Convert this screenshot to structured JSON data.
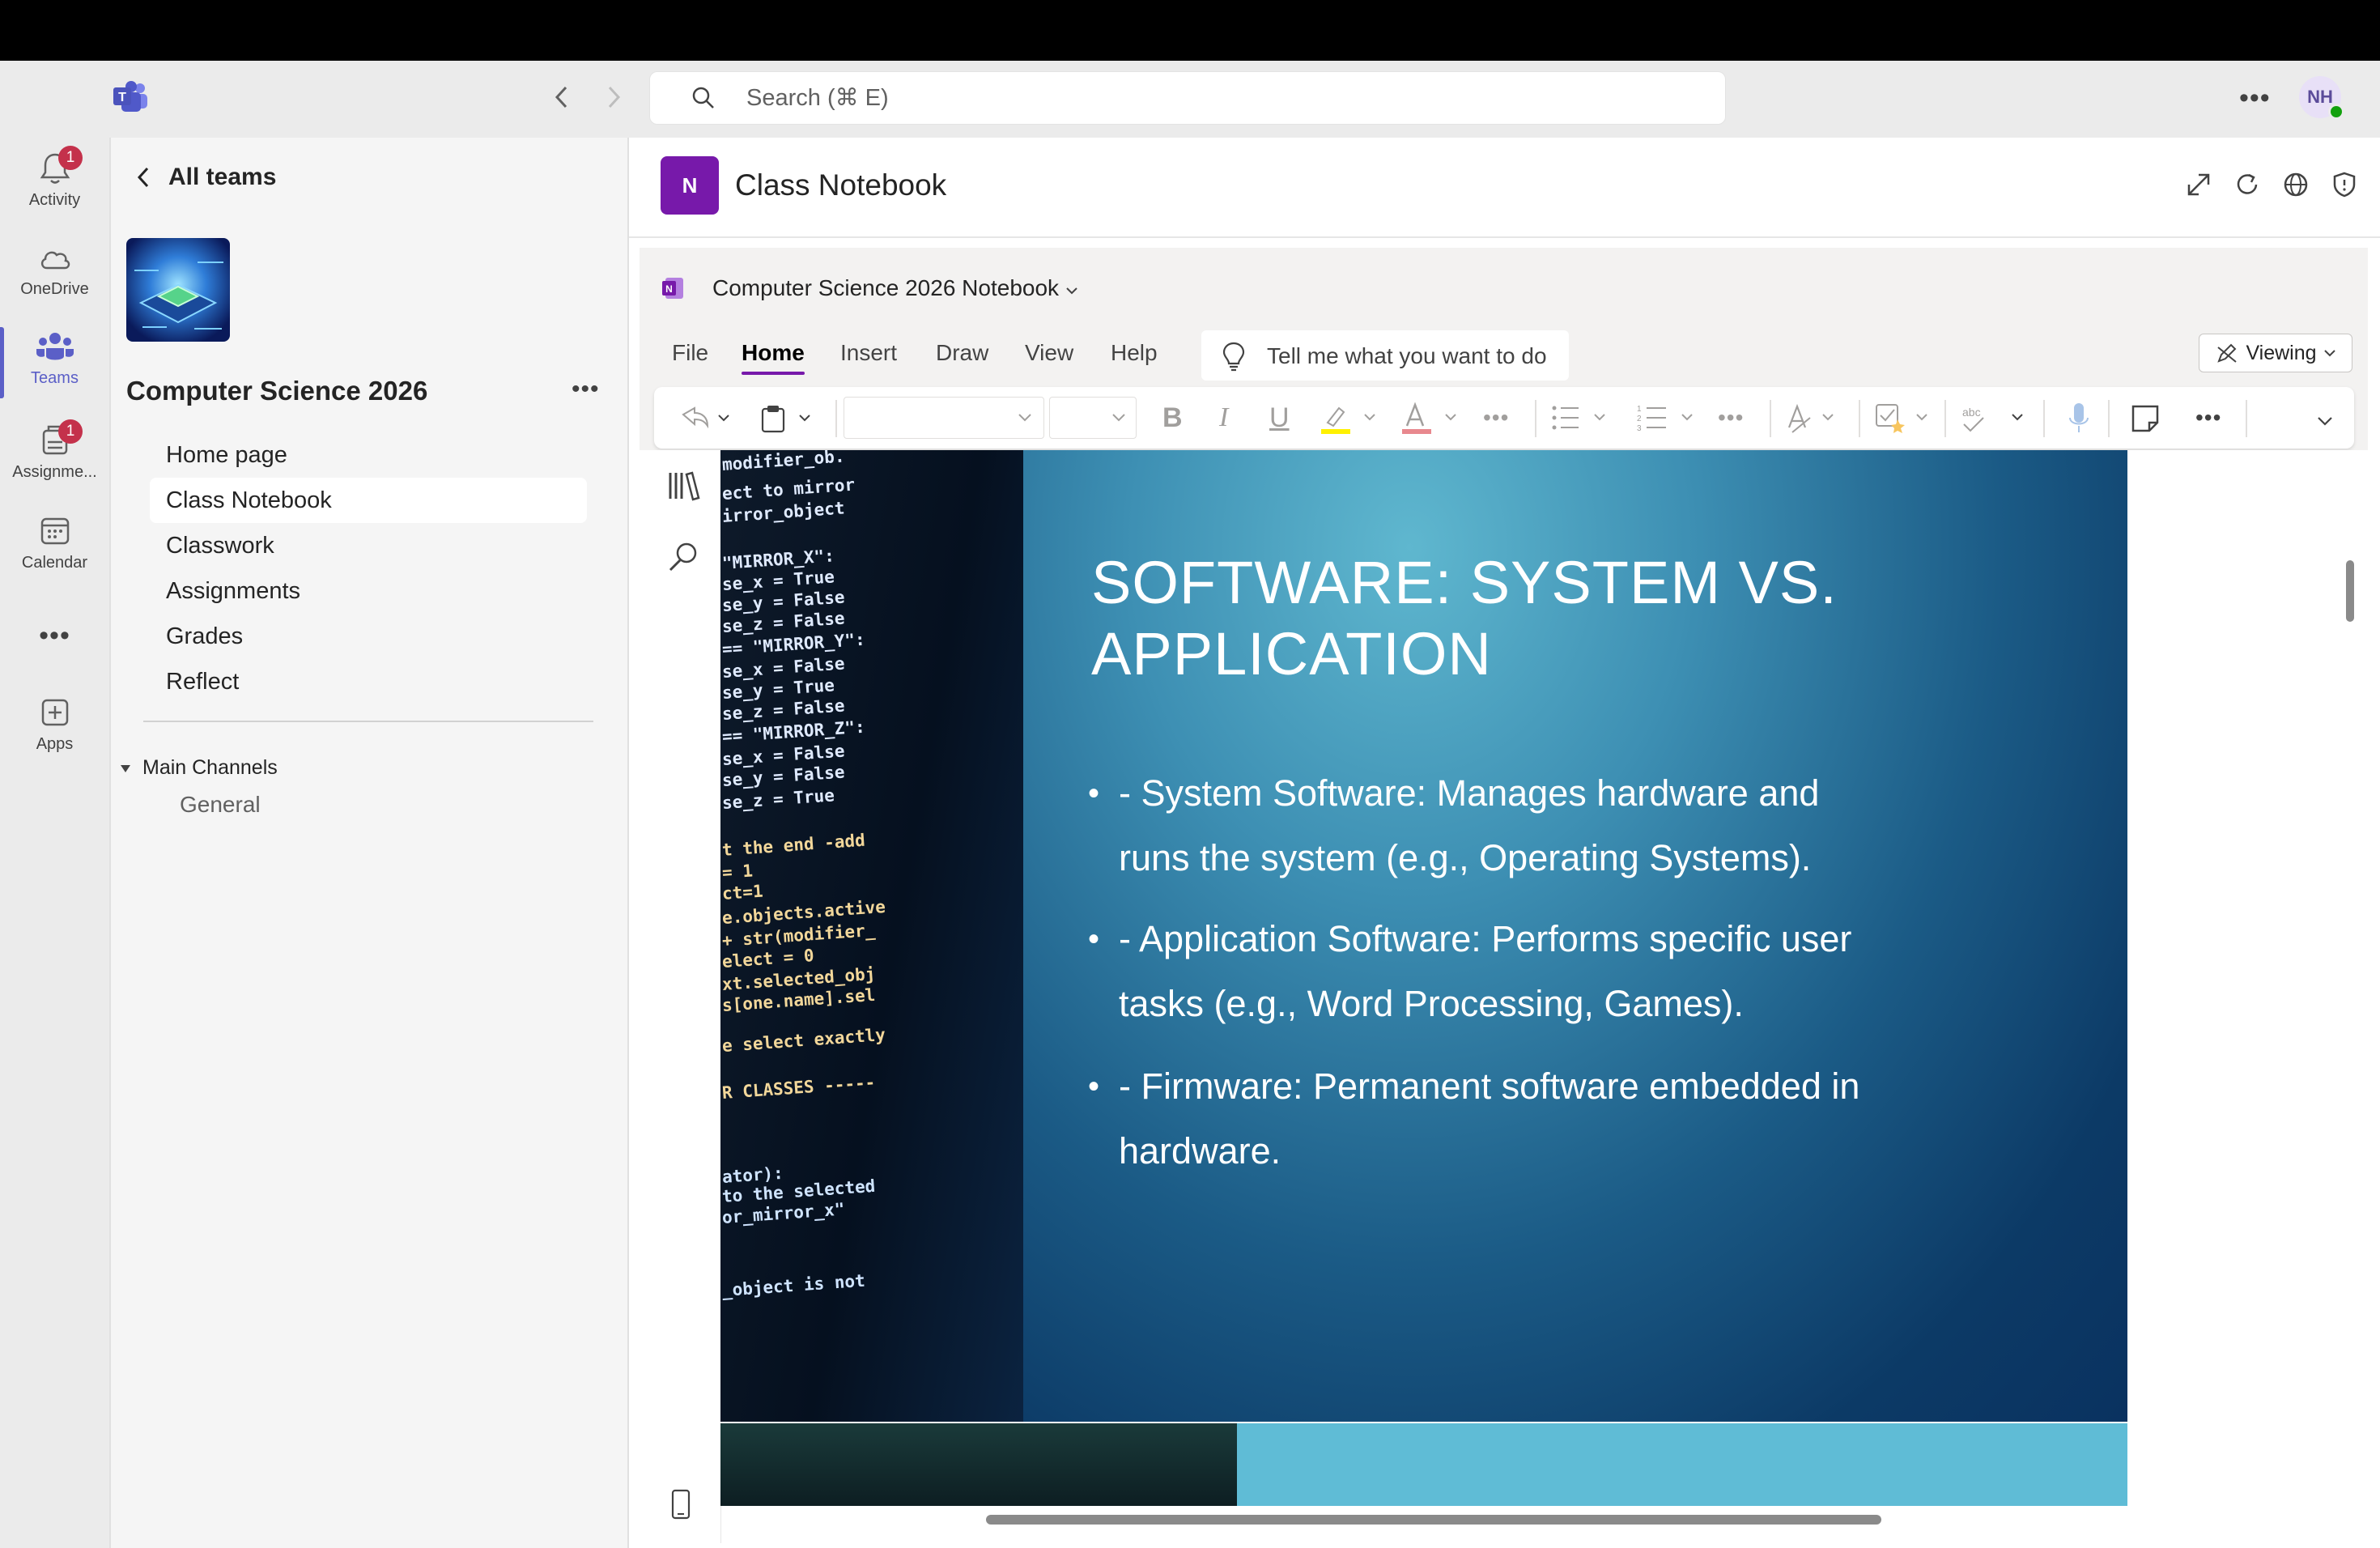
{
  "search": {
    "placeholder": "Search (⌘ E)"
  },
  "user": {
    "initials": "NH"
  },
  "rail": {
    "items": [
      {
        "label": "Activity",
        "badge": "1",
        "icon": "bell-icon"
      },
      {
        "label": "OneDrive",
        "icon": "cloud-icon"
      },
      {
        "label": "Teams",
        "icon": "teams-icon"
      },
      {
        "label": "Assignme...",
        "badge": "1",
        "icon": "assignments-icon"
      },
      {
        "label": "Calendar",
        "icon": "calendar-icon"
      },
      {
        "label": "Apps",
        "icon": "add-app-icon"
      }
    ]
  },
  "panel": {
    "back_label": "All teams",
    "team_name": "Computer Science 2026",
    "channels": [
      "Home page",
      "Class Notebook",
      "Classwork",
      "Assignments",
      "Grades",
      "Reflect"
    ],
    "section_label": "Main Channels",
    "section_items": [
      "General"
    ]
  },
  "app": {
    "title": "Class Notebook",
    "notebook_name": "Computer Science 2026 Notebook",
    "menu_tabs": [
      "File",
      "Home",
      "Insert",
      "Draw",
      "View",
      "Help"
    ],
    "active_tab": "Home",
    "tell_me": "Tell me what you want to do",
    "mode": "Viewing"
  },
  "slide": {
    "title_line1": "SOFTWARE: SYSTEM VS.",
    "title_line2": "APPLICATION",
    "bullets": [
      {
        "line1": "- System Software: Manages hardware and",
        "line2": "runs the system (e.g., Operating Systems)."
      },
      {
        "line1": "- Application Software: Performs specific user",
        "line2": "tasks (e.g., Word Processing, Games)."
      },
      {
        "line1": "- Firmware: Permanent software embedded in",
        "line2": "hardware."
      }
    ],
    "code_lines": [
      "modifier_ob.",
      "ect to mirror",
      "irror_object",
      "\"MIRROR_X\":",
      "se_x = True",
      "se_y = False",
      "se_z = False",
      "== \"MIRROR_Y\":",
      "se_x = False",
      "se_y = True",
      "se_z = False",
      "== \"MIRROR_Z\":",
      "se_x = False",
      "se_y = False",
      "se_z = True",
      "t the end -add",
      "= 1",
      "ct=1",
      "e.objects.active",
      " + str(modifier_",
      "elect = 0",
      "xt.selected_obj",
      "s[one.name].sel",
      "e select exactly",
      "R CLASSES -----",
      "ator):",
      " to the selected",
      "or_mirror_x\"",
      "_object is not"
    ]
  },
  "colors": {
    "accent": "#5b5fc7",
    "onenote": "#7719aa",
    "badge": "#c4314b"
  }
}
